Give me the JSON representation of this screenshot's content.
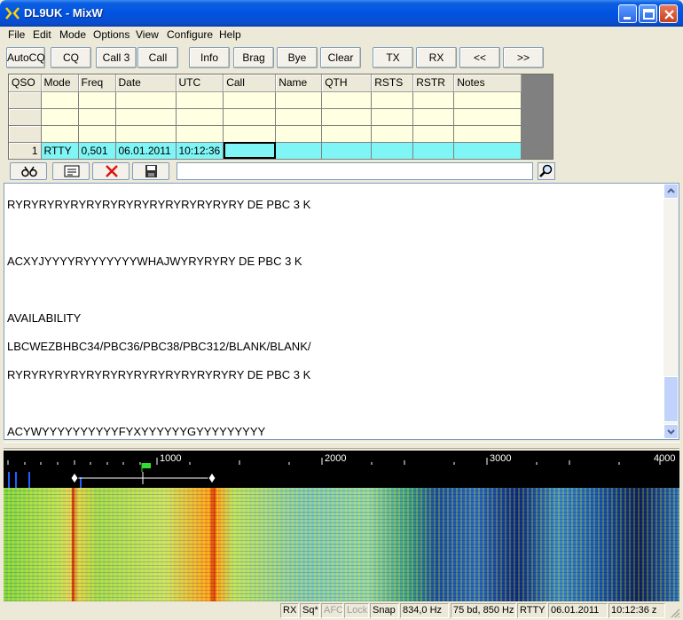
{
  "window": {
    "title": "DL9UK - MixW"
  },
  "menu": [
    "File",
    "Edit",
    "Mode",
    "Options",
    "View",
    "Configure",
    "Help"
  ],
  "toolbar": [
    "AutoCQ",
    "CQ",
    "Call 3",
    "Call",
    "Info",
    "Brag",
    "Bye",
    "Clear",
    "TX",
    "RX",
    "<<",
    ">>"
  ],
  "log": {
    "columns": [
      "QSO",
      "Mode",
      "Freq",
      "Date",
      "UTC",
      "Call",
      "Name",
      "QTH",
      "RSTS",
      "RSTR",
      "Notes"
    ],
    "current": {
      "qso": "1",
      "mode": "RTTY",
      "freq": "0,501",
      "date": "06.01.2011",
      "utc": "10:12:36",
      "call": "",
      "name": "",
      "qth": "",
      "rsts": "",
      "rstr": "",
      "notes": ""
    }
  },
  "icons": {
    "smallbar": [
      "binoculars-icon",
      "card-icon",
      "delete-icon",
      "save-icon"
    ],
    "find": "search-icon"
  },
  "receive": {
    "lines": [
      "RYRYRYRYRYRYRYRYRYRYRYRYRYRYRY DE PBC 3 K",
      "ACXYJYYYYRYYYYYYYWHAJWYRYRYRY DE PBC 3 K",
      "AVAILABILITY",
      "LBCWEZBHBC34/PBC36/PBC38/PBC312/BLANK/BLANK/",
      "RYRYRYRYRYRYRYRYRYRYRYRYRYRYRY DE PBC 3 K",
      "ACYWYYYYYYYYYYFYXYYYYYYGYYYYYYYYY"
    ]
  },
  "spectrum": {
    "scale": [
      "1000",
      "2000",
      "3000",
      "4000"
    ]
  },
  "status": {
    "rx": "RX",
    "sq": "Sq*",
    "afc": "AFC",
    "lock": "Lock",
    "snap": "Snap",
    "freq": "834,0 Hz",
    "baud": "75 bd, 850 Hz",
    "mode": "RTTY",
    "date": "06.01.2011",
    "time": "10:12:36 z"
  },
  "colors": {
    "title_bar": "#0054e3",
    "log_empty": "#ffffe1",
    "log_active": "#7ff5f5"
  }
}
